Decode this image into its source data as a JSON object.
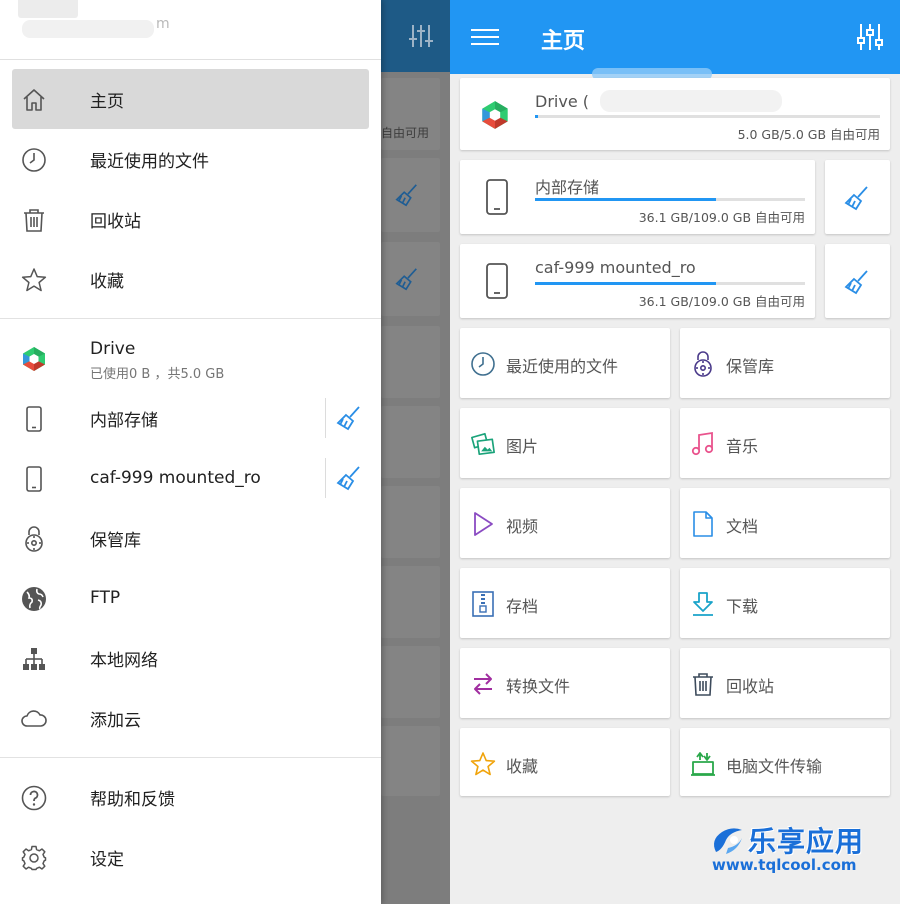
{
  "colors": {
    "primary": "#2196f3",
    "drawer_active": "#d9d9d9",
    "broom": "#2a8ee6"
  },
  "drawer": {
    "account_email_tail": "m",
    "nav": [
      {
        "label": "主页",
        "icon": "home-icon",
        "active": true
      },
      {
        "label": "最近使用的文件",
        "icon": "clock-icon"
      },
      {
        "label": "回收站",
        "icon": "trash-icon"
      },
      {
        "label": "收藏",
        "icon": "star-icon"
      }
    ],
    "storage": [
      {
        "label": "Drive",
        "sub": "已使用0 B ，共5.0 GB",
        "icon": "drive-logo-icon"
      },
      {
        "label": "内部存储",
        "icon": "phone-icon",
        "cleanable": true
      },
      {
        "label": "caf-999 mounted_ro",
        "icon": "phone-icon",
        "cleanable": true
      },
      {
        "label": "保管库",
        "icon": "vault-icon"
      },
      {
        "label": "FTP",
        "icon": "globe-icon"
      },
      {
        "label": "本地网络",
        "icon": "network-icon"
      },
      {
        "label": "添加云",
        "icon": "cloud-icon"
      }
    ],
    "footer": [
      {
        "label": "帮助和反馈",
        "icon": "help-icon"
      },
      {
        "label": "设定",
        "icon": "gear-icon"
      }
    ]
  },
  "dimmed_background": {
    "free_text": "自由可用"
  },
  "appbar": {
    "title": "主页"
  },
  "storage_cards": [
    {
      "name": "Drive (",
      "size": "5.0 GB/5.0 GB 自由可用",
      "fill": 0.01,
      "icon": "drive-logo-icon"
    },
    {
      "name": "内部存储",
      "size": "36.1 GB/109.0 GB 自由可用",
      "fill": 0.67,
      "icon": "phone-icon"
    },
    {
      "name": "caf-999 mounted_ro",
      "size": "36.1 GB/109.0 GB 自由可用",
      "fill": 0.67,
      "icon": "phone-icon"
    }
  ],
  "tiles": [
    {
      "label": "最近使用的文件",
      "icon": "clock-icon"
    },
    {
      "label": "保管库",
      "icon": "vault-icon"
    },
    {
      "label": "图片",
      "icon": "images-icon"
    },
    {
      "label": "音乐",
      "icon": "music-icon"
    },
    {
      "label": "视频",
      "icon": "video-icon"
    },
    {
      "label": "文档",
      "icon": "document-icon"
    },
    {
      "label": "存档",
      "icon": "archive-icon"
    },
    {
      "label": "下载",
      "icon": "download-icon"
    },
    {
      "label": "转换文件",
      "icon": "convert-icon"
    },
    {
      "label": "回收站",
      "icon": "trash-icon"
    },
    {
      "label": "收藏",
      "icon": "star-icon"
    },
    {
      "label": "电脑文件传输",
      "icon": "pc-transfer-icon"
    }
  ],
  "watermark": {
    "title": "乐享应用",
    "url": "www.tqlcool.com"
  }
}
